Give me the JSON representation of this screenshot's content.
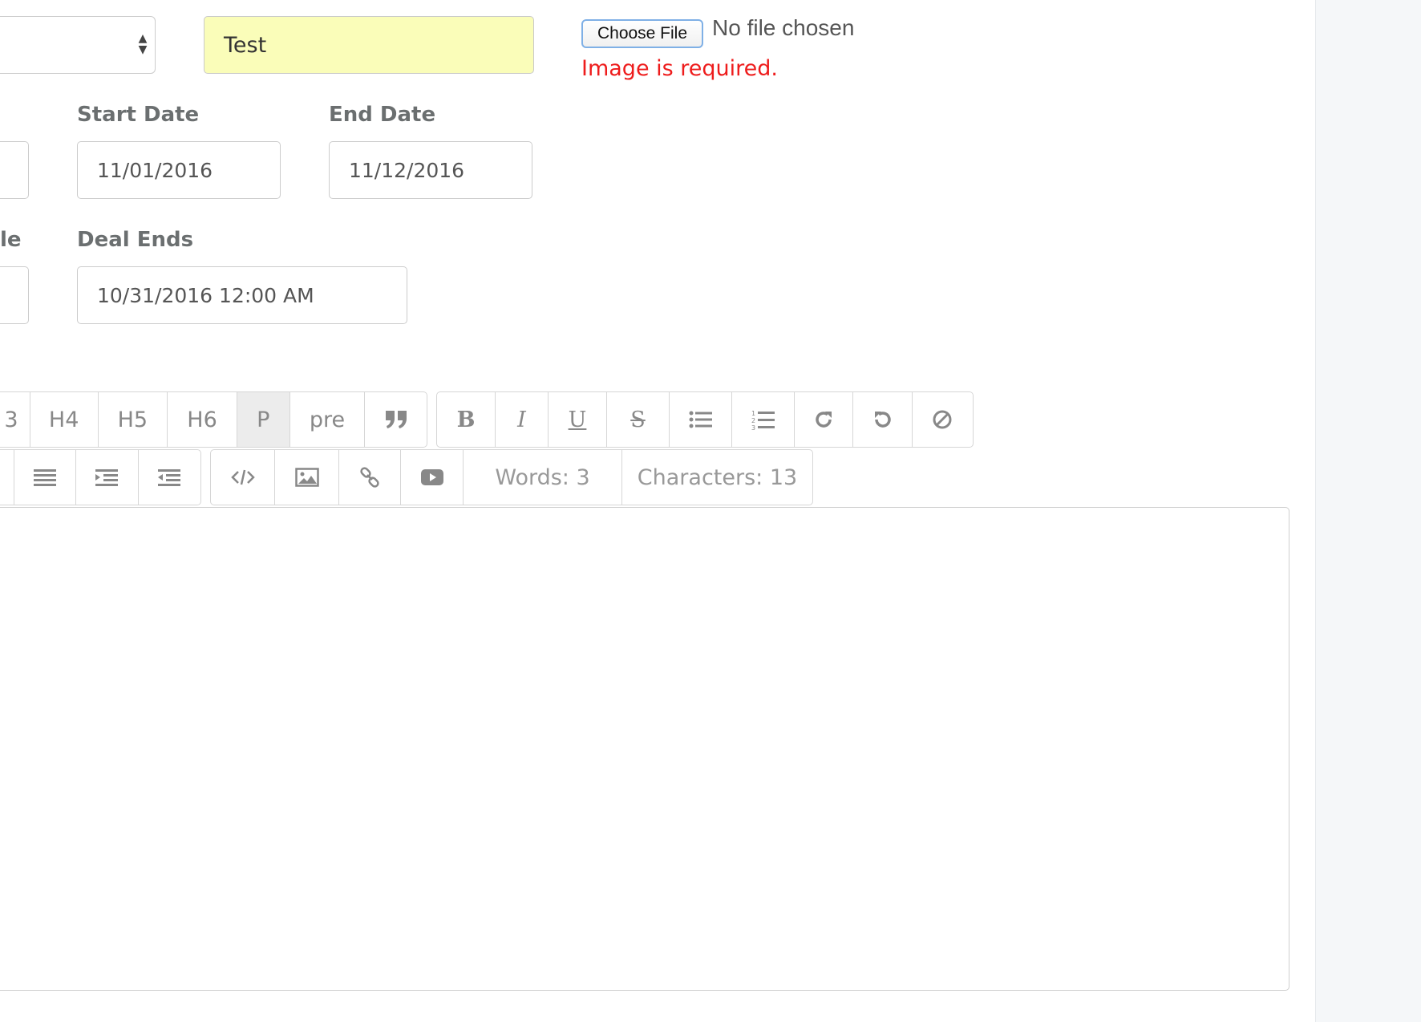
{
  "form": {
    "category_select": {
      "value": ""
    },
    "title_input": {
      "value": "Test"
    },
    "image_upload": {
      "button_label": "Choose File",
      "status": "No file chosen",
      "error": "Image is required."
    },
    "start_date": {
      "label": "Start Date",
      "value": "11/01/2016"
    },
    "end_date": {
      "label": "End Date",
      "value": "11/12/2016"
    },
    "partial_label": "le",
    "deal_ends": {
      "label": "Deal Ends",
      "value": "10/31/2016 12:00 AM"
    }
  },
  "toolbar": {
    "row1_headings": [
      "3",
      "H4",
      "H5",
      "H6",
      "P",
      "pre"
    ],
    "active_heading": "P",
    "row1_icons": [
      "quote-icon",
      "bold-icon",
      "italic-icon",
      "underline-icon",
      "strikethrough-icon",
      "bullet-list-icon",
      "numbered-list-icon",
      "redo-icon",
      "undo-icon",
      "clear-format-icon"
    ],
    "bold_glyph": "B",
    "italic_glyph": "I",
    "underline_glyph": "U",
    "strike_glyph": "S",
    "row2_icons": [
      "justify-icon",
      "indent-icon",
      "outdent-icon",
      "code-icon",
      "image-icon",
      "link-icon",
      "video-icon"
    ],
    "words": "Words: 3",
    "characters": "Characters: 13"
  },
  "colors": {
    "error": "#ee1c1c",
    "highlight_input": "#fafdb9",
    "active_button": "#ececec",
    "right_panel": "#f5f7f9"
  }
}
